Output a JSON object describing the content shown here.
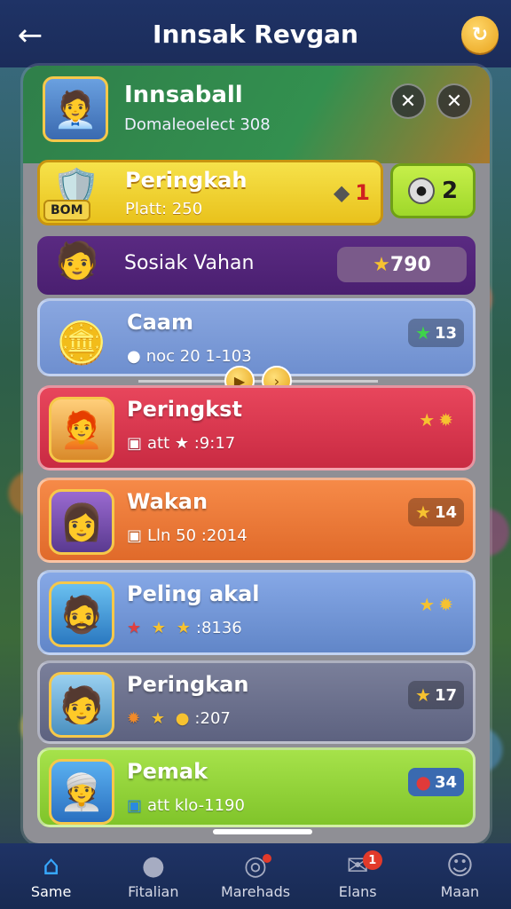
{
  "topbar": {
    "title": "Innsak Revgan",
    "back_icon": "arrow-left-icon",
    "coin_icon": "coin-icon"
  },
  "header": {
    "title": "Innsaball",
    "subtitle": "Domaleoelect 308"
  },
  "rank": {
    "title": "Peringkah",
    "subtitle": "Platt: 250",
    "tag": "BOM",
    "score": "1",
    "badge_value": "2"
  },
  "social": {
    "title": "Sosiak Vahan",
    "score": "790"
  },
  "cards": [
    {
      "title": "Caam",
      "meta": "noc 20 1-103",
      "badge": "13",
      "color": "#6e8fcf"
    },
    {
      "title": "Peringkst",
      "meta": "att ★ :9:17",
      "badge": "",
      "color": "#d8324a"
    },
    {
      "title": "Wakan",
      "meta": "Lln 50 :2014",
      "badge": "14",
      "color": "#ec7a3a"
    },
    {
      "title": "Peling akal",
      "meta": ":8136",
      "badge": "",
      "color": "#6d93d6"
    },
    {
      "title": "Peringkan",
      "meta": ":207",
      "badge": "17",
      "color": "#6b6f8a"
    },
    {
      "title": "Pemak",
      "meta": "att  klo-1190",
      "badge": "34",
      "color": "#8fd23a"
    }
  ],
  "nav": [
    {
      "label": "Same",
      "icon": "home-icon",
      "active": true
    },
    {
      "label": "Fitalian",
      "icon": "chat-bubble-icon",
      "active": false
    },
    {
      "label": "Marehads",
      "icon": "compass-icon",
      "active": false
    },
    {
      "label": "Elans",
      "icon": "envelope-icon",
      "active": false,
      "badge": "1"
    },
    {
      "label": "Maan",
      "icon": "people-icon",
      "active": false
    }
  ]
}
